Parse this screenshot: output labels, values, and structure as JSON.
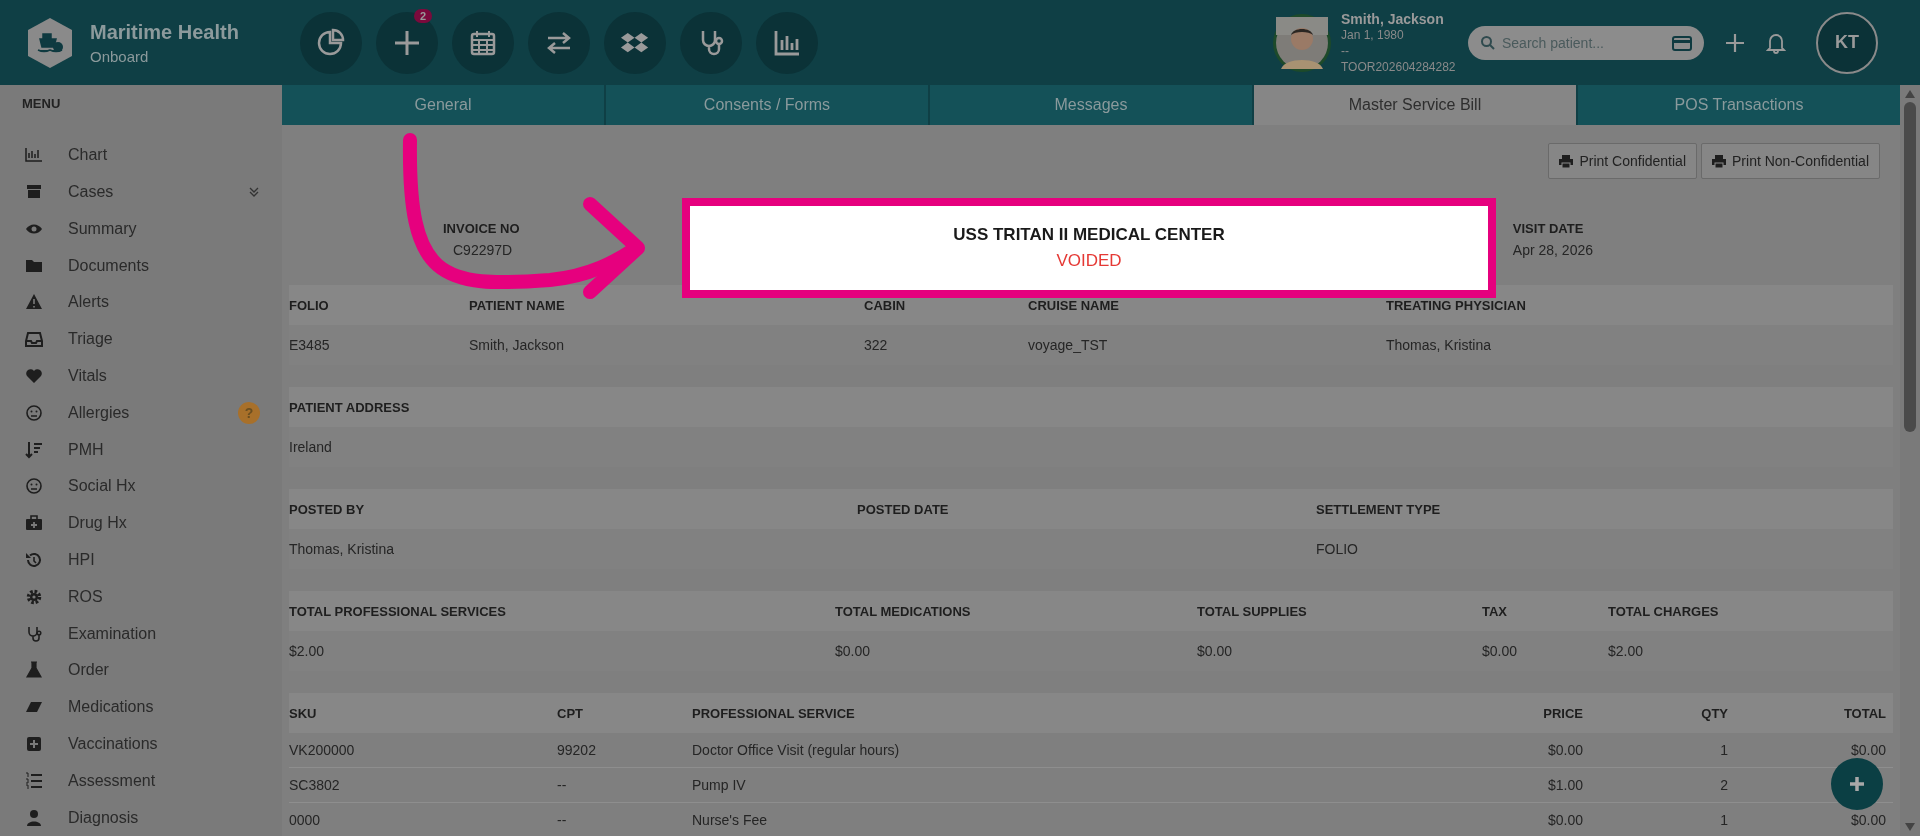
{
  "brand": {
    "name": "Maritime Health",
    "subtitle": "Onboard"
  },
  "toolbar_badge": "2",
  "patient": {
    "name": "Smith, Jackson",
    "dob": "Jan 1, 1980",
    "line_3": "--",
    "id": "TOOR202604284282"
  },
  "search": {
    "placeholder": "Search patient..."
  },
  "user_initials": "KT",
  "tabs": [
    {
      "label": "General",
      "selected": false
    },
    {
      "label": "Consents / Forms",
      "selected": false
    },
    {
      "label": "Messages",
      "selected": false
    },
    {
      "label": "Master Service Bill",
      "selected": true
    },
    {
      "label": "POS Transactions",
      "selected": false
    }
  ],
  "menu": {
    "title": "MENU",
    "items": [
      {
        "label": "Chart"
      },
      {
        "label": "Cases",
        "expandable": true
      },
      {
        "label": "Summary"
      },
      {
        "label": "Documents"
      },
      {
        "label": "Alerts"
      },
      {
        "label": "Triage"
      },
      {
        "label": "Vitals"
      },
      {
        "label": "Allergies",
        "badge": "?"
      },
      {
        "label": "PMH"
      },
      {
        "label": "Social Hx"
      },
      {
        "label": "Drug Hx"
      },
      {
        "label": "HPI"
      },
      {
        "label": "ROS"
      },
      {
        "label": "Examination"
      },
      {
        "label": "Order"
      },
      {
        "label": "Medications"
      },
      {
        "label": "Vaccinations"
      },
      {
        "label": "Assessment"
      },
      {
        "label": "Diagnosis"
      }
    ]
  },
  "print_buttons": [
    "Print Confidential",
    "Print Non-Confidential"
  ],
  "invoice": {
    "invoice_no": {
      "label": "INVOICE NO",
      "value": "C92297D"
    },
    "visit_date": {
      "label": "VISIT DATE",
      "value": "Apr 28, 2026"
    }
  },
  "sections": [
    {
      "cells": [
        {
          "header": "FOLIO",
          "value": "E3485"
        },
        {
          "header": "PATIENT NAME",
          "value": "Smith, Jackson"
        },
        {
          "header": "CABIN",
          "value": "322"
        },
        {
          "header": "CRUISE NAME",
          "value": "voyage_TST"
        },
        {
          "header": "TREATING PHYSICIAN",
          "value": "Thomas, Kristina"
        }
      ]
    },
    {
      "cells": [
        {
          "header": "PATIENT ADDRESS",
          "value": "Ireland"
        }
      ]
    },
    {
      "cells": [
        {
          "header": "POSTED BY",
          "value": "Thomas, Kristina"
        },
        {
          "header": "POSTED DATE"
        },
        {
          "header": "SETTLEMENT TYPE",
          "value": "FOLIO"
        }
      ]
    },
    {
      "cells": [
        {
          "header": "TOTAL PROFESSIONAL SERVICES",
          "value": "$2.00"
        },
        {
          "header": "TOTAL MEDICATIONS",
          "value": "$0.00"
        },
        {
          "header": "TOTAL SUPPLIES",
          "value": "$0.00"
        },
        {
          "header": "TAX",
          "value": "$0.00"
        },
        {
          "header": "TOTAL CHARGES",
          "value": "$2.00"
        }
      ]
    }
  ],
  "services": {
    "columns": [
      "SKU",
      "CPT",
      "PROFESSIONAL SERVICE",
      "PRICE",
      "QTY",
      "TOTAL"
    ],
    "rows": [
      [
        "VK200000",
        "99202",
        "Doctor Office Visit (regular hours)",
        "$0.00",
        "1",
        "$0.00"
      ],
      [
        "SC3802",
        "--",
        "Pump IV",
        "$1.00",
        "2"
      ],
      [
        "0000",
        "--",
        "Nurse's Fee",
        "$0.00",
        "1",
        "$0.00"
      ]
    ]
  },
  "highlight": {
    "title": "USS TRITAN II MEDICAL CENTER",
    "status": "VOIDED"
  }
}
